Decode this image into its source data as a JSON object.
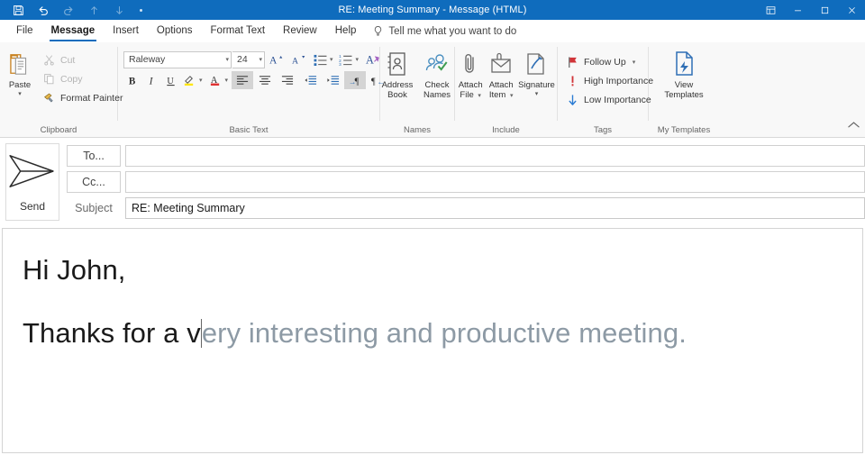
{
  "window": {
    "title": "RE: Meeting Summary  -  Message (HTML)",
    "quick_access": [
      {
        "name": "save-icon",
        "label": "Save",
        "enabled": true
      },
      {
        "name": "undo-icon",
        "label": "Undo",
        "enabled": true
      },
      {
        "name": "redo-icon",
        "label": "Redo",
        "enabled": false
      },
      {
        "name": "previous-item-icon",
        "label": "Previous Item",
        "enabled": false
      },
      {
        "name": "next-item-icon",
        "label": "Next Item",
        "enabled": false
      },
      {
        "name": "customize-quick-access-toolbar-icon",
        "label": "Customize Quick Access Toolbar",
        "enabled": true
      }
    ],
    "controls": [
      {
        "name": "ribbon-display-options-button",
        "label": "Ribbon Display Options"
      },
      {
        "name": "minimize-button",
        "label": "Minimize"
      },
      {
        "name": "maximize-button",
        "label": "Maximize"
      },
      {
        "name": "close-button",
        "label": "Close"
      }
    ],
    "accent_color": "#0f6cbd"
  },
  "tabs": [
    {
      "label": "File",
      "active": false
    },
    {
      "label": "Message",
      "active": true
    },
    {
      "label": "Insert",
      "active": false
    },
    {
      "label": "Options",
      "active": false
    },
    {
      "label": "Format Text",
      "active": false
    },
    {
      "label": "Review",
      "active": false
    },
    {
      "label": "Help",
      "active": false
    }
  ],
  "tell_me": {
    "icon": "lightbulb-icon",
    "label": "Tell me what you want to do"
  },
  "ribbon": {
    "collapse_label": "Collapse the Ribbon",
    "groups": [
      {
        "name": "clipboard",
        "label": "Clipboard",
        "has_dialog_launcher": true,
        "big_button": {
          "label": "Paste",
          "icon": "clipboard-icon",
          "has_caret": true,
          "enabled": true
        },
        "small_buttons": [
          {
            "label": "Cut",
            "icon": "scissors-icon",
            "enabled": false
          },
          {
            "label": "Copy",
            "icon": "copy-icon",
            "enabled": false
          },
          {
            "label": "Format Painter",
            "icon": "format-painter-icon",
            "enabled": true
          }
        ]
      },
      {
        "name": "basic-text",
        "label": "Basic Text",
        "has_dialog_launcher": true,
        "font_name": "Raleway",
        "font_size": "24",
        "row1": [
          {
            "label": "Increase Font Size",
            "icon": "grow-font-icon"
          },
          {
            "label": "Decrease Font Size",
            "icon": "shrink-font-icon"
          },
          {
            "label": "Bullets",
            "icon": "bullet-list-icon",
            "has_caret": true
          },
          {
            "label": "Numbering",
            "icon": "numbered-list-icon",
            "has_caret": true
          },
          {
            "label": "Clear All Formatting",
            "icon": "clear-formatting-icon"
          }
        ],
        "row2": [
          {
            "label": "Bold",
            "icon": "bold-icon",
            "active": false
          },
          {
            "label": "Italic",
            "icon": "italic-icon",
            "active": false
          },
          {
            "label": "Underline",
            "icon": "underline-icon",
            "active": false
          },
          {
            "label": "Text Highlight Color",
            "icon": "highlight-icon",
            "has_caret": true,
            "color": "#ffe600"
          },
          {
            "label": "Font Color",
            "icon": "font-color-icon",
            "has_caret": true,
            "color": "#e03030"
          },
          {
            "label": "Align Left",
            "icon": "align-left-icon",
            "active": true
          },
          {
            "label": "Center",
            "icon": "align-center-icon",
            "active": false
          },
          {
            "label": "Align Right",
            "icon": "align-right-icon",
            "active": false
          },
          {
            "label": "Decrease Indent",
            "icon": "decrease-indent-icon",
            "active": false
          },
          {
            "label": "Increase Indent",
            "icon": "increase-indent-icon",
            "active": false
          },
          {
            "label": "Left-to-Right Text Direction",
            "icon": "ltr-text-direction-icon",
            "active": true
          },
          {
            "label": "Right-to-Left Text Direction",
            "icon": "rtl-text-direction-icon",
            "active": false
          }
        ]
      },
      {
        "name": "names",
        "label": "Names",
        "has_dialog_launcher": false,
        "buttons": [
          {
            "label_line1": "Address",
            "label_line2": "Book",
            "icon": "address-book-icon",
            "has_caret": false
          },
          {
            "label_line1": "Check",
            "label_line2": "Names",
            "icon": "check-names-icon",
            "has_caret": false
          }
        ]
      },
      {
        "name": "include",
        "label": "Include",
        "has_dialog_launcher": false,
        "buttons": [
          {
            "label_line1": "Attach",
            "label_line2": "File",
            "icon": "paperclip-icon",
            "has_caret": true
          },
          {
            "label_line1": "Attach",
            "label_line2": "Item",
            "icon": "attach-item-icon",
            "has_caret": true
          },
          {
            "label_line1": "Signature",
            "label_line2": "",
            "icon": "signature-icon",
            "has_caret": true
          }
        ]
      },
      {
        "name": "tags",
        "label": "Tags",
        "has_dialog_launcher": true,
        "small_buttons": [
          {
            "label": "Follow Up",
            "icon": "flag-icon",
            "has_caret": true,
            "color": "#d13438"
          },
          {
            "label": "High Importance",
            "icon": "high-importance-icon",
            "color": "#d13438"
          },
          {
            "label": "Low Importance",
            "icon": "low-importance-icon",
            "color": "#2b7cd3"
          }
        ]
      },
      {
        "name": "my-templates",
        "label": "My Templates",
        "has_dialog_launcher": false,
        "big_button": {
          "label_line1": "View",
          "label_line2": "Templates",
          "icon": "view-templates-icon"
        }
      }
    ]
  },
  "compose": {
    "send_button": {
      "label": "Send",
      "icon": "send-plane-icon"
    },
    "to": {
      "button_label": "To...",
      "value": "",
      "placeholder": ""
    },
    "cc": {
      "button_label": "Cc...",
      "value": "",
      "placeholder": ""
    },
    "subject": {
      "label": "Subject",
      "value": "RE: Meeting Summary",
      "placeholder": ""
    }
  },
  "body": {
    "greeting": "Hi John,",
    "typed_text": "Thanks for a v",
    "suggested_text": "ery interesting and productive meeting.",
    "suggestion_color": "#8d9aa5",
    "typed_color": "#1a1a1a"
  }
}
